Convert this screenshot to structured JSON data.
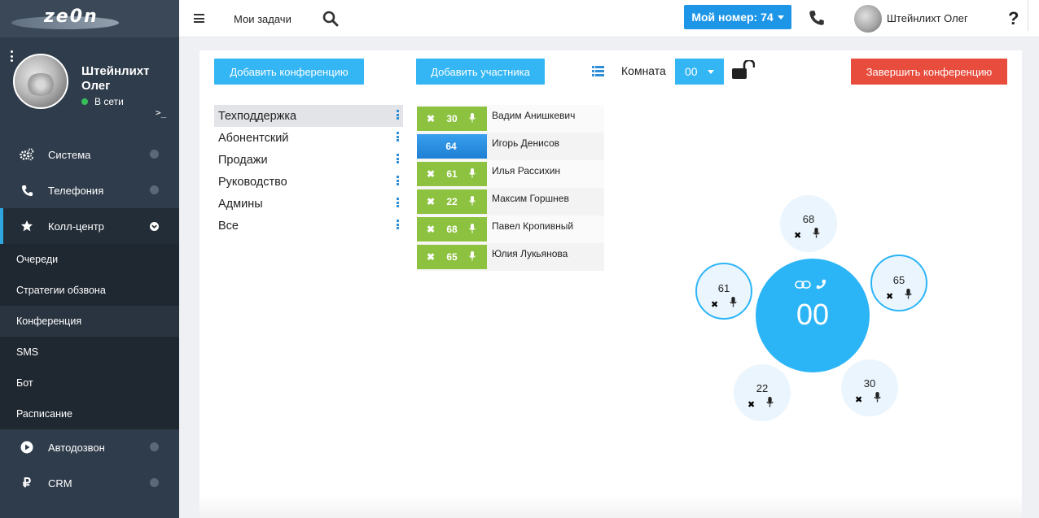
{
  "app": {
    "logo": "ze0n"
  },
  "user": {
    "name": "Штейнлихт Олег",
    "status": "В сети",
    "terminal": ">_"
  },
  "sidebar": {
    "items": [
      {
        "label": "Система",
        "icon": "gears-icon"
      },
      {
        "label": "Телефония",
        "icon": "phone-icon"
      },
      {
        "label": "Колл-центр",
        "icon": "star-icon"
      }
    ],
    "sub_items": [
      {
        "label": "Очереди"
      },
      {
        "label": "Стратегии обзвона"
      },
      {
        "label": "Конференция"
      },
      {
        "label": "SMS"
      },
      {
        "label": "Бот"
      },
      {
        "label": "Расписание"
      }
    ],
    "bottom_items": [
      {
        "label": "Автодозвон",
        "icon": "play-icon"
      },
      {
        "label": "CRM",
        "icon": "ruble-icon"
      }
    ]
  },
  "topbar": {
    "tasks": "Мои задачи",
    "my_number": "Мой номер: 74",
    "user_name": "Штейнлихт Олег",
    "help": "?"
  },
  "toolbar": {
    "add_conference": "Добавить конференцию",
    "add_participant": "Добавить участника",
    "room_label": "Комната",
    "room_value": "00",
    "end_conference": "Завершить конференцию"
  },
  "conferences": [
    "Техподдержка",
    "Абонентский",
    "Продажи",
    "Руководство",
    "Админы",
    "Все"
  ],
  "participants": [
    {
      "ext": "30",
      "name": "Вадим Анишкевич"
    },
    {
      "ext": "64",
      "name": "Игорь Денисов"
    },
    {
      "ext": "61",
      "name": "Илья Рассихин"
    },
    {
      "ext": "22",
      "name": "Максим Горшнев"
    },
    {
      "ext": "68",
      "name": "Павел Кропивный"
    },
    {
      "ext": "65",
      "name": "Юлия Лукьянова"
    }
  ],
  "room": {
    "number": "00",
    "members": [
      "68",
      "61",
      "65",
      "22",
      "30"
    ]
  },
  "colors": {
    "accent": "#34b6f5",
    "green": "#8cc23f",
    "danger": "#e84c3d",
    "sidebar": "#2f3c4b"
  }
}
